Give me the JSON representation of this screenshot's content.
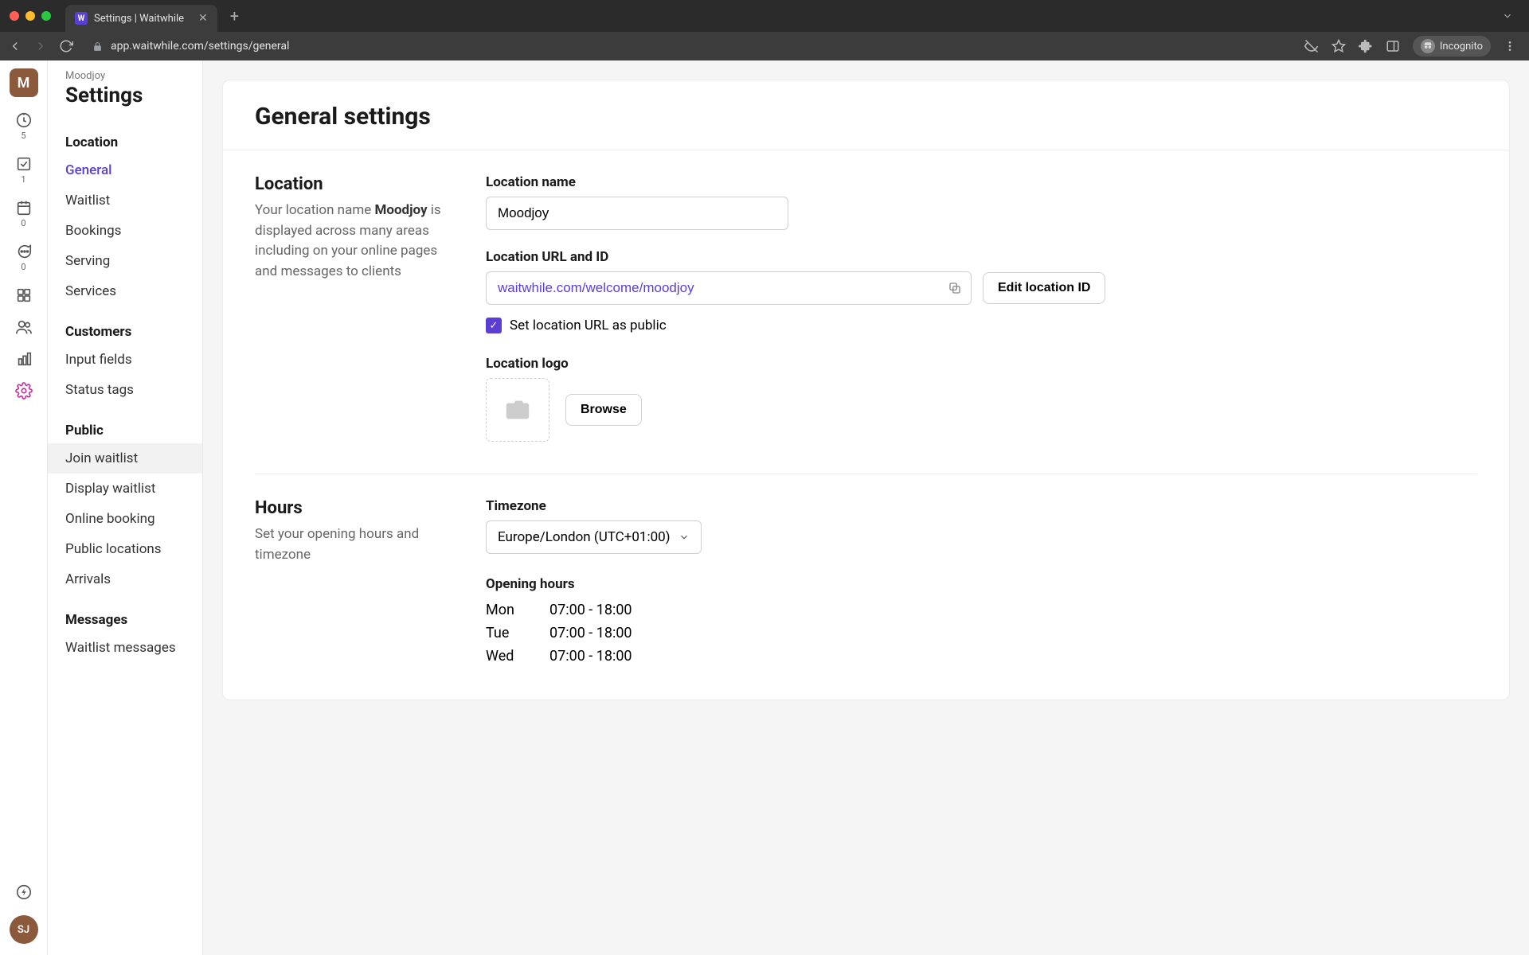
{
  "browser": {
    "tab_title": "Settings | Waitwhile",
    "url": "app.waitwhile.com/settings/general",
    "incognito_label": "Incognito"
  },
  "rail": {
    "logo_letter": "M",
    "items": [
      {
        "badge": "5"
      },
      {
        "badge": "1"
      },
      {
        "badge": "0"
      },
      {
        "badge": "0"
      }
    ],
    "avatar": "SJ"
  },
  "header": {
    "breadcrumb": "Moodjoy",
    "title": "Settings"
  },
  "sidebar": {
    "groups": [
      {
        "heading": "Location",
        "items": [
          "General",
          "Waitlist",
          "Bookings",
          "Serving",
          "Services"
        ]
      },
      {
        "heading": "Customers",
        "items": [
          "Input fields",
          "Status tags"
        ]
      },
      {
        "heading": "Public",
        "items": [
          "Join waitlist",
          "Display waitlist",
          "Online booking",
          "Public locations",
          "Arrivals"
        ]
      },
      {
        "heading": "Messages",
        "items": [
          "Waitlist messages"
        ]
      }
    ],
    "active": "General",
    "hover": "Join waitlist"
  },
  "main": {
    "title": "General settings",
    "location": {
      "heading": "Location",
      "desc_prefix": "Your location name ",
      "desc_bold": "Moodjoy",
      "desc_suffix": " is displayed across many areas including on your online pages and messages to clients",
      "name_label": "Location name",
      "name_value": "Moodjoy",
      "url_label": "Location URL and ID",
      "url_value": "waitwhile.com/welcome/moodjoy",
      "edit_button": "Edit location ID",
      "public_checkbox": "Set location URL as public",
      "logo_label": "Location logo",
      "browse_button": "Browse"
    },
    "hours": {
      "heading": "Hours",
      "desc": "Set your opening hours and timezone",
      "tz_label": "Timezone",
      "tz_value": "Europe/London (UTC+01:00)",
      "opening_label": "Opening hours",
      "rows": [
        {
          "day": "Mon",
          "time": "07:00 - 18:00"
        },
        {
          "day": "Tue",
          "time": "07:00 - 18:00"
        },
        {
          "day": "Wed",
          "time": "07:00 - 18:00"
        }
      ]
    }
  }
}
